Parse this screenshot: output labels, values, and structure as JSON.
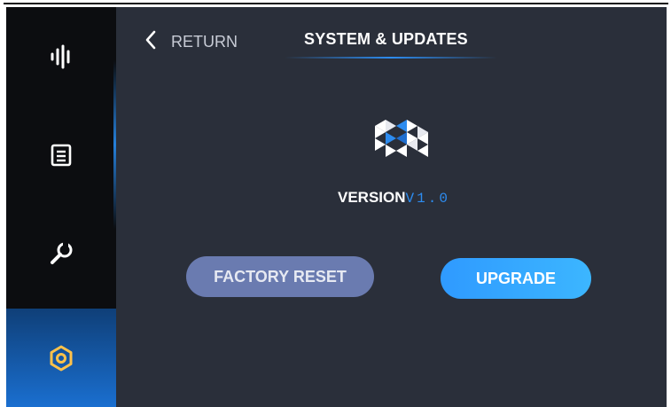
{
  "header": {
    "return_label": "RETURN",
    "title": "SYSTEM & UPDATES"
  },
  "sidebar": {
    "items": [
      {
        "icon": "waveform-icon",
        "active": false
      },
      {
        "icon": "list-document-icon",
        "active": false
      },
      {
        "icon": "wrench-icon",
        "active": false
      },
      {
        "icon": "gear-icon",
        "active": true
      }
    ]
  },
  "version": {
    "label": "VERSION",
    "value": "V1.0"
  },
  "buttons": {
    "factory_reset": "FACTORY RESET",
    "upgrade": "UPGRADE"
  },
  "colors": {
    "accent": "#2d8cf0",
    "background": "#2a2f3a",
    "sidebar": "#0c0d10",
    "reset_button": "#6a7bb0"
  }
}
